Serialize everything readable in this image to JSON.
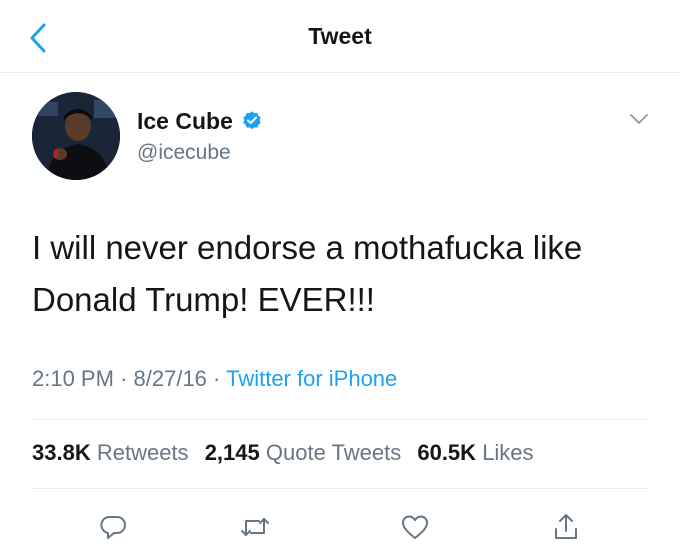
{
  "header": {
    "title": "Tweet",
    "back_icon": "chevron-left-icon",
    "accent_color": "#1da1f2"
  },
  "author": {
    "display_name": "Ice Cube",
    "handle": "@icecube",
    "verified_icon": "verified-badge-icon",
    "menu_icon": "chevron-down-icon"
  },
  "tweet": {
    "text_line1": "I will never endorse a mothafucka like",
    "text_line2": "Donald Trump! EVER!!!"
  },
  "meta": {
    "time": "2:10 PM",
    "separator": "·",
    "date": "8/27/16",
    "source": "Twitter for iPhone"
  },
  "stats": {
    "retweets_count": "33.8K",
    "retweets_label": "Retweets",
    "quotes_count": "2,145",
    "quotes_label": "Quote Tweets",
    "likes_count": "60.5K",
    "likes_label": "Likes"
  },
  "actions": {
    "reply_icon": "reply-icon",
    "retweet_icon": "retweet-icon",
    "like_icon": "heart-icon",
    "share_icon": "share-icon"
  }
}
